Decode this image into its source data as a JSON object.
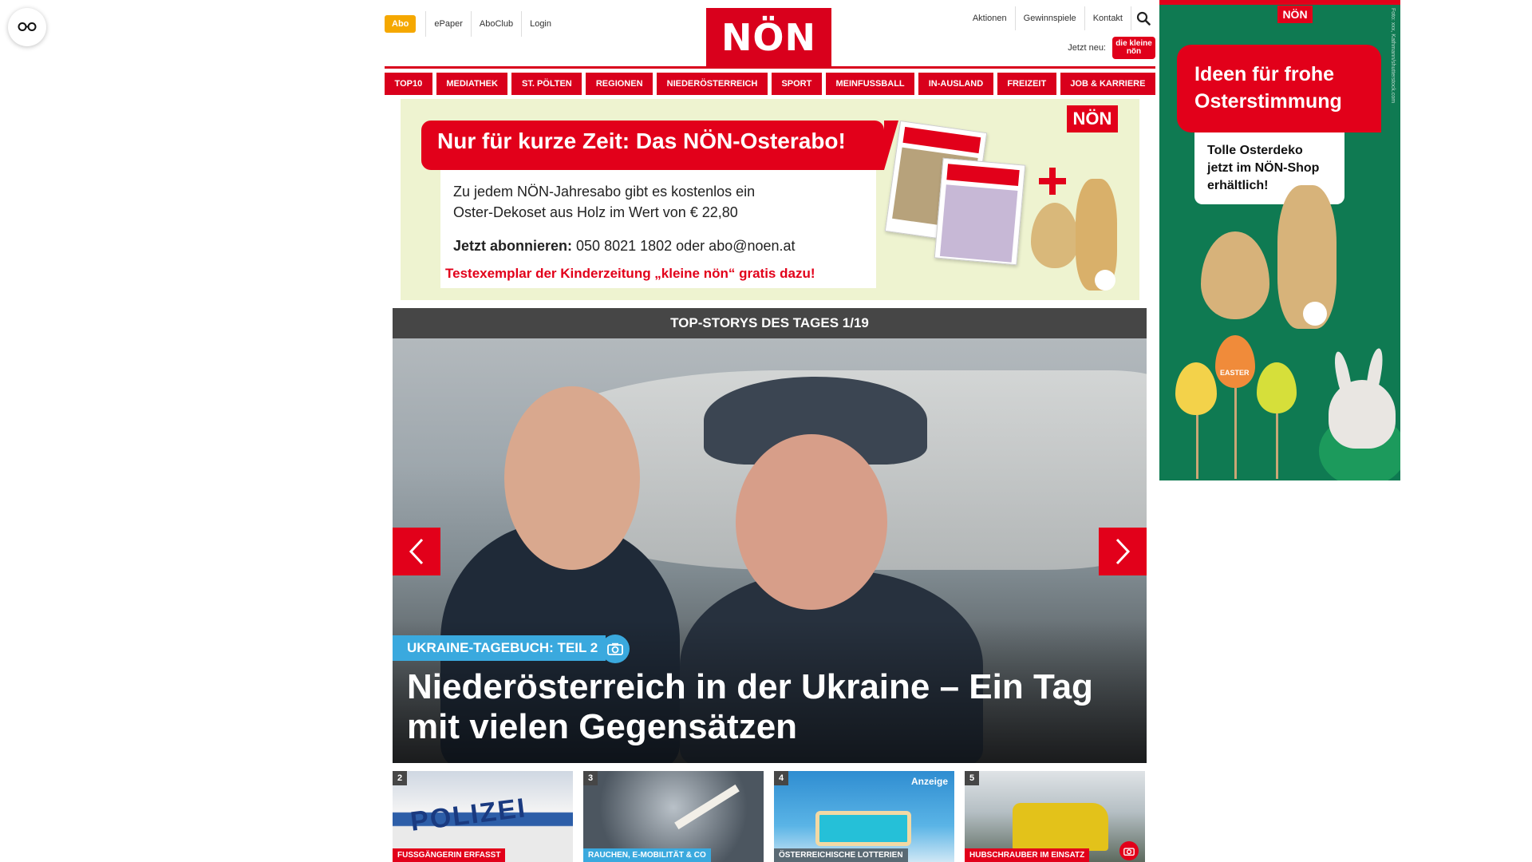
{
  "header": {
    "abo": "Abo",
    "left_links": [
      "ePaper",
      "AboClub",
      "Login"
    ],
    "logo": "NÖN",
    "right_links": [
      "Aktionen",
      "Gewinnspiele",
      "Kontakt"
    ],
    "jetzt_neu": "Jetzt neu:",
    "kleine_logo": "die kleine nön"
  },
  "nav": [
    "TOP10",
    "MEDIATHEK",
    "ST. PÖLTEN",
    "REGIONEN",
    "NIEDERÖSTERREICH",
    "SPORT",
    "MEINFUSSBALL",
    "IN-AUSLAND",
    "FREIZEIT",
    "JOB & KARRIERE"
  ],
  "promo": {
    "title": "Nur für kurze Zeit: Das NÖN-Osterabo!",
    "line1": "Zu jedem NÖN-Jahresabo gibt es kostenlos ein",
    "line2": "Oster-Dekoset aus Holz im Wert von € 22,80",
    "cta_bold": "Jetzt abonnieren:",
    "cta_text": " 050 8021 1802 oder abo@noen.at",
    "red_line": "Testexemplar der Kinderzeitung „kleine nön“ gratis dazu!",
    "badge": "NÖN"
  },
  "top_stories": {
    "header": "TOP-STORYS DES TAGES 1/19",
    "kicker": "UKRAINE-TAGEBUCH: TEIL 2",
    "headline": "Niederösterreich in der Ukraine – Ein Tag mit vielen Gegensätzen"
  },
  "teasers": [
    {
      "num": "2",
      "tag": "FUSSGÄNGERIN ERFASST",
      "label": "POLIZEI"
    },
    {
      "num": "3",
      "tag": "RAUCHEN, E-MOBILITÄT & CO"
    },
    {
      "num": "4",
      "tag": "ÖSTERREICHISCHE LOTTERIEN",
      "anzeige": "Anzeige"
    },
    {
      "num": "5",
      "tag": "HUBSCHRAUBER IM EINSATZ"
    }
  ],
  "ad": {
    "logo": "NÖN",
    "title": "Ideen für frohe Osterstimmung",
    "sub": "Tolle Osterdeko jetzt im NÖN-Shop erhältlich!",
    "credit": "Foto: xxx, Kathmann/shutterstock.com",
    "egg_label": "EASTER"
  },
  "colors": {
    "brand_red": "#d9001c",
    "accent_blue": "#3aa9de",
    "abo_yellow": "#f5a800",
    "ad_green": "#0f7a52"
  }
}
